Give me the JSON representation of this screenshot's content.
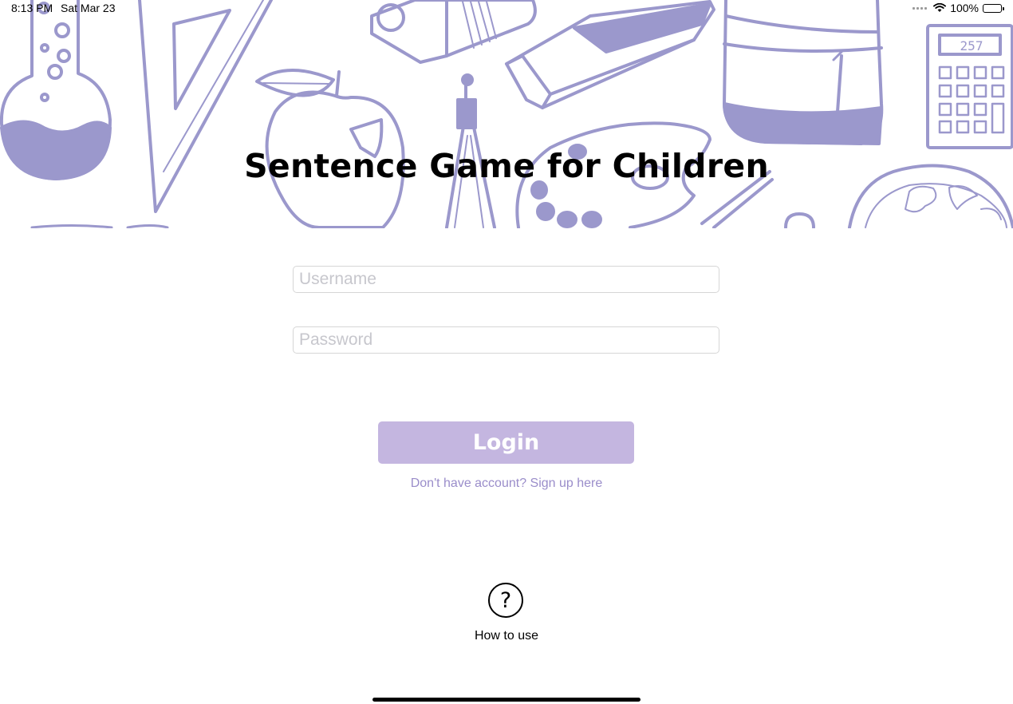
{
  "status_bar": {
    "time": "8:13 PM",
    "date": "Sat Mar 23",
    "battery": "100%"
  },
  "header": {
    "title": "Sentence Game for Children",
    "illustration": "school-supplies-doodle",
    "calculator_display": "257"
  },
  "login_form": {
    "username_placeholder": "Username",
    "username_value": "",
    "password_placeholder": "Password",
    "password_value": "",
    "login_label": "Login",
    "signup_label": "Don't have account? Sign up here"
  },
  "help": {
    "icon": "question-circle-icon",
    "glyph": "?",
    "label": "How to use"
  },
  "colors": {
    "accent": "#c4b6e0",
    "doodle": "#9b98cc",
    "link": "#9a8dca"
  }
}
